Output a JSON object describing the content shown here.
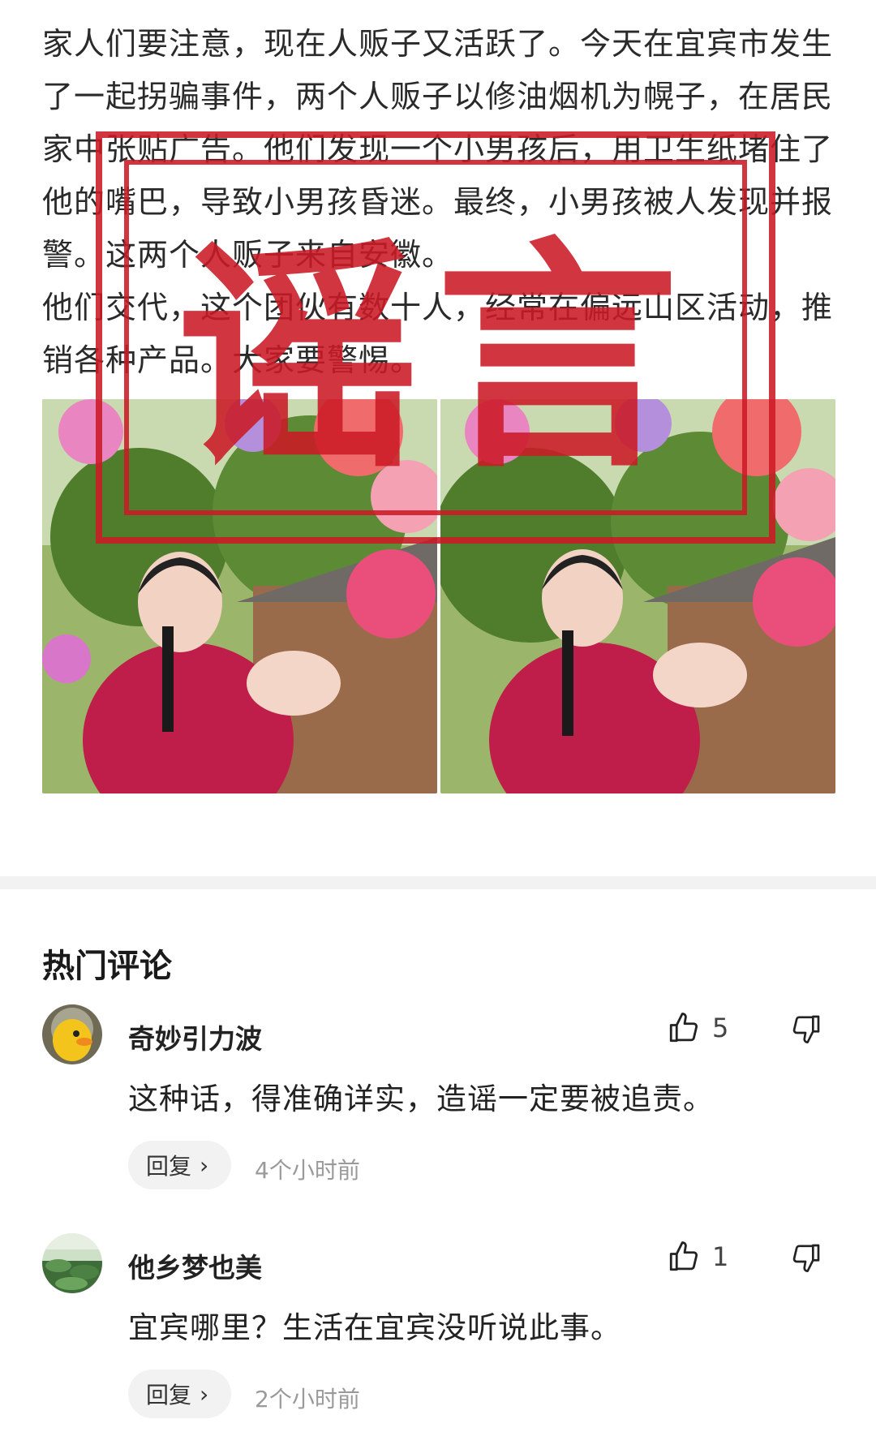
{
  "article": {
    "paragraphs": [
      "家人们要注意，现在人贩子又活跃了。今天在宜宾市发生了一起拐骗事件，两个人贩子以修油烟机为幌子，在居民家中张贴广告。他们发现一个小男孩后，用卫生纸堵住了他的嘴巴，导致小男孩昏迷。最终，小男孩被人发现并报警。这两个人贩子来自安徽。",
      "他们交代，这个团伙有数十人，经常在偏远山区活动，推销各种产品。大家要警惕。"
    ]
  },
  "stamp": {
    "text": "谣言",
    "color": "#cb1a26"
  },
  "comments_section": {
    "title": "热门评论",
    "reply_label": "回复",
    "reply_chevron": "›",
    "items": [
      {
        "username": "奇妙引力波",
        "avatar_icon": "yellow-duck-avatar",
        "text": "这种话，得准确详实，造谣一定要被追责。",
        "likes": "5",
        "time": "4个小时前"
      },
      {
        "username": "他乡梦也美",
        "avatar_icon": "lotus-pond-avatar",
        "text": "宜宾哪里？生活在宜宾没听说此事。",
        "likes": "1",
        "time": "2个小时前"
      }
    ]
  }
}
